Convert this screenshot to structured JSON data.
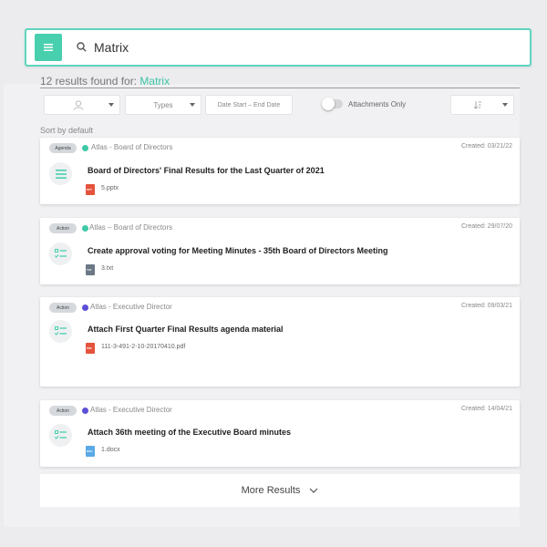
{
  "search": {
    "value": "Matrix",
    "placeholder": ""
  },
  "results": {
    "prefix": "12 results found for:",
    "query": "Matrix"
  },
  "filters": {
    "types_label": "Types",
    "date_range_label": "Date Start – End Date",
    "attachments_label": "Attachments Only",
    "attachments_only": false
  },
  "sort_label": "Sort by default",
  "cards": [
    {
      "badge": "Agenda",
      "source": "Atlas - Board of Directors",
      "created": "Created: 03/21/22",
      "title": "Board of Directors' Final Results for the Last Quarter of 2021",
      "file": "5.pptx",
      "dot_color": "#3ec9a7",
      "file_color": "#e5533d",
      "icon": "list-icon"
    },
    {
      "badge": "Action",
      "source": "Atlas – Board of Directors",
      "created": "Created: 29/07/20",
      "title": "Create approval voting for Meeting Minutes - 35th Board of Directors Meeting",
      "file": "3.txt",
      "dot_color": "#3ec9a7",
      "file_color": "#6b7785",
      "icon": "checklist-icon"
    },
    {
      "badge": "Action",
      "source": "Atlas - Executive Director",
      "created": "Created: 09/03/21",
      "title": "Attach First Quarter Final Results agenda material",
      "file": "111-3-491-2-10-20170410.pdf",
      "dot_color": "#5b4fd6",
      "file_color": "#e5533d",
      "icon": "checklist-icon"
    },
    {
      "badge": "Action",
      "source": "Atlas - Executive Director",
      "created": "Created: 14/04/21",
      "title": "Attach 36th meeting of the Executive Board minutes",
      "file": "1.docx",
      "dot_color": "#5b4fd6",
      "file_color": "#5aa9e6",
      "icon": "checklist-icon"
    }
  ],
  "more_label": "More Results",
  "colors": {
    "accent": "#48cfae",
    "border": "#5ed6bd",
    "query": "#3cc4a4"
  }
}
